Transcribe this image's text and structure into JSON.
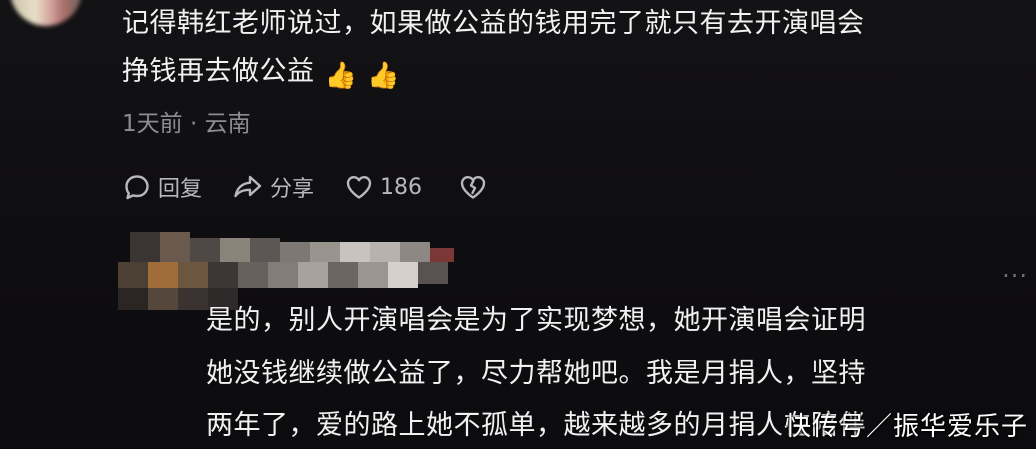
{
  "comment": {
    "text_line1": "记得韩红老师说过，如果做公益的钱用完了就只有去开演唱会",
    "text_line2": "挣钱再去做公益",
    "emojis": [
      "👍",
      "👍"
    ],
    "meta": "1天前 · 云南"
  },
  "actions": {
    "reply_label": "回复",
    "share_label": "分享",
    "like_count": "186",
    "reply_icon": "comment-bubble-icon",
    "share_icon": "share-arrow-icon",
    "like_icon": "heart-icon",
    "dislike_icon": "broken-heart-icon"
  },
  "reply": {
    "more_label": "···",
    "text_line1": "是的，别人开演唱会是为了实现梦想，她开演唱会证明",
    "text_line2": "她没钱继续做公益了，尽力帮她吧。我是月捐人，坚持",
    "text_line3": "两年了，爱的路上她不孤单，越来越多的月捐人在陪伴"
  },
  "watermark": {
    "text": "快传号／振华爱乐子"
  },
  "colors": {
    "background": "#0f0e10",
    "primary_text": "#f1f1f1",
    "secondary_text": "#8e8c90",
    "action_text": "#b9b7bb"
  }
}
